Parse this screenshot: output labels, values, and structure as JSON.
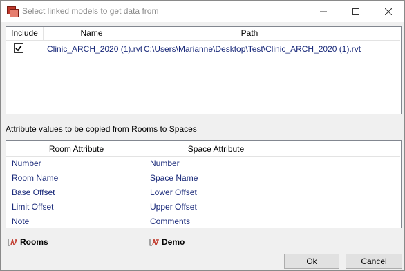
{
  "window": {
    "title": "Select linked models to get data from",
    "controls": {
      "minimize": "minimize-icon",
      "maximize": "maximize-icon",
      "close": "close-icon"
    }
  },
  "linked_models": {
    "columns": [
      "Include",
      "Name",
      "Path"
    ],
    "rows": [
      {
        "include": true,
        "name": "Clinic_ARCH_2020 (1).rvt",
        "path": "C:\\Users\\Marianne\\Desktop\\Test\\Clinic_ARCH_2020 (1).rvt"
      }
    ]
  },
  "attributes_section": {
    "label": "Attribute values to be copied from Rooms to Spaces",
    "columns": [
      "Room Attribute",
      "Space Attribute"
    ],
    "rows": [
      {
        "room": "Number",
        "space": "Number"
      },
      {
        "room": "Room Name",
        "space": "Space Name"
      },
      {
        "room": "Base Offset",
        "space": "Lower Offset"
      },
      {
        "room": "Limit Offset",
        "space": "Upper Offset"
      },
      {
        "room": "Note",
        "space": "Comments"
      }
    ]
  },
  "tags": {
    "rooms": "Rooms",
    "demo": "Demo"
  },
  "buttons": {
    "ok": "Ok",
    "cancel": "Cancel"
  },
  "colors": {
    "value_text": "#1a2a7a",
    "title_text": "#8c8c8c",
    "icon_red": "#c0392b"
  }
}
